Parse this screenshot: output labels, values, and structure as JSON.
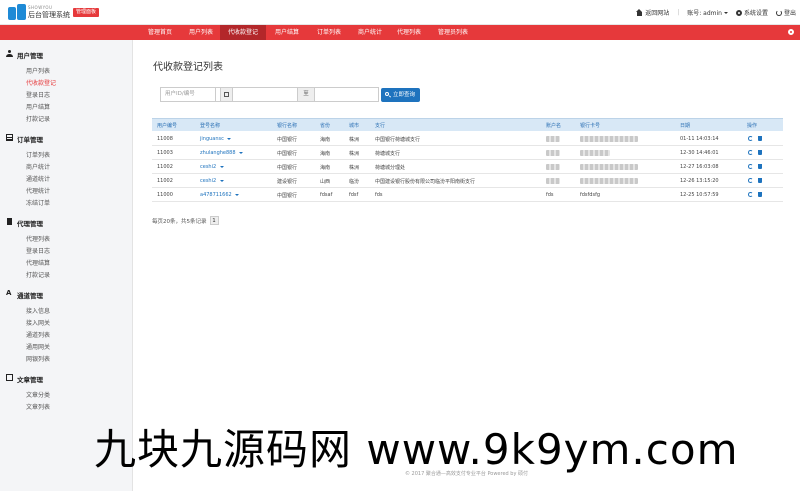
{
  "brand": {
    "small": "SHOWYOU",
    "name": "后台管理系统",
    "badge": "管理面板"
  },
  "top_right": {
    "site": "返回网站",
    "account": "账号: admin",
    "settings": "系统设置",
    "logout": "登出"
  },
  "nav": {
    "tabs": [
      {
        "label": "管理首页",
        "active": false
      },
      {
        "label": "用户列表",
        "active": false
      },
      {
        "label": "代收款登记",
        "active": true
      },
      {
        "label": "用户结算",
        "active": false
      },
      {
        "label": "订单列表",
        "active": false
      },
      {
        "label": "商户统计",
        "active": false
      },
      {
        "label": "代理列表",
        "active": false
      },
      {
        "label": "管理员列表",
        "active": false
      }
    ]
  },
  "sidebar": {
    "groups": [
      {
        "title": "用户管理",
        "icon": "user-icon",
        "items": [
          "用户列表",
          "代收款登记",
          "登录日志",
          "用户结算",
          "打款记录"
        ],
        "active_item": 1
      },
      {
        "title": "订单管理",
        "icon": "table-icon",
        "items": [
          "订单列表",
          "商户统计",
          "通道统计",
          "代理统计",
          "冻结订单"
        ],
        "active_item": -1
      },
      {
        "title": "代理管理",
        "icon": "document-icon",
        "items": [
          "代理列表",
          "登录日志",
          "代理结算",
          "打款记录"
        ],
        "active_item": -1
      },
      {
        "title": "通道管理",
        "icon": "font-icon",
        "items": [
          "接入信息",
          "接入网关",
          "通道列表",
          "通用网关",
          "网银列表"
        ],
        "active_item": -1
      },
      {
        "title": "文章管理",
        "icon": "book-icon",
        "items": [
          "文章分类",
          "文章列表"
        ],
        "active_item": -1
      }
    ]
  },
  "main": {
    "title": "代收款登记列表",
    "search": {
      "user_placeholder": "用户ID/编号",
      "to_label": "至",
      "button_label": "立即查询"
    },
    "columns": [
      "用户编号",
      "登号名称",
      "银行名称",
      "省份",
      "城市",
      "支行",
      "账户名",
      "银行卡号",
      "日期",
      "操作"
    ],
    "rows": [
      {
        "id": "11008",
        "name": "jinguansc",
        "bank": "中国银行",
        "province": "海南",
        "city": "株洲",
        "branch": "中国银行荷塘城支行",
        "account": "",
        "card": "",
        "date": "01-11 14:03:14"
      },
      {
        "id": "11003",
        "name": "zhulanghe888",
        "bank": "中国银行",
        "province": "海南",
        "city": "株洲",
        "branch": "荷塘城支行",
        "account": "",
        "card": "",
        "date": "12-30 14:46:01"
      },
      {
        "id": "11002",
        "name": "ceshi2",
        "bank": "中国银行",
        "province": "海南",
        "city": "株洲",
        "branch": "荷塘城分理处",
        "account": "",
        "card": "",
        "date": "12-27 16:03:08"
      },
      {
        "id": "11002",
        "name": "ceshi2",
        "bank": "建设银行",
        "province": "山西",
        "city": "临汾",
        "branch": "中国建设银行股份有限公司临汾平阳南街支行",
        "account": "",
        "card": "",
        "date": "12-26 13:15:20"
      },
      {
        "id": "11000",
        "name": "a478711662",
        "bank": "中国银行",
        "province": "fdsaf",
        "city": "fdsf",
        "branch": "fds",
        "account": "fds",
        "card": "fdsfdsfg",
        "date": "12-25 10:57:59"
      }
    ],
    "pager": {
      "summary": "每页20条，共5条记录",
      "current": "1"
    },
    "footer": "© 2017 聚合通—高效支付专业平台 Powered by 硕付"
  },
  "watermark": "九块九源码网 www.9k9ym.com"
}
